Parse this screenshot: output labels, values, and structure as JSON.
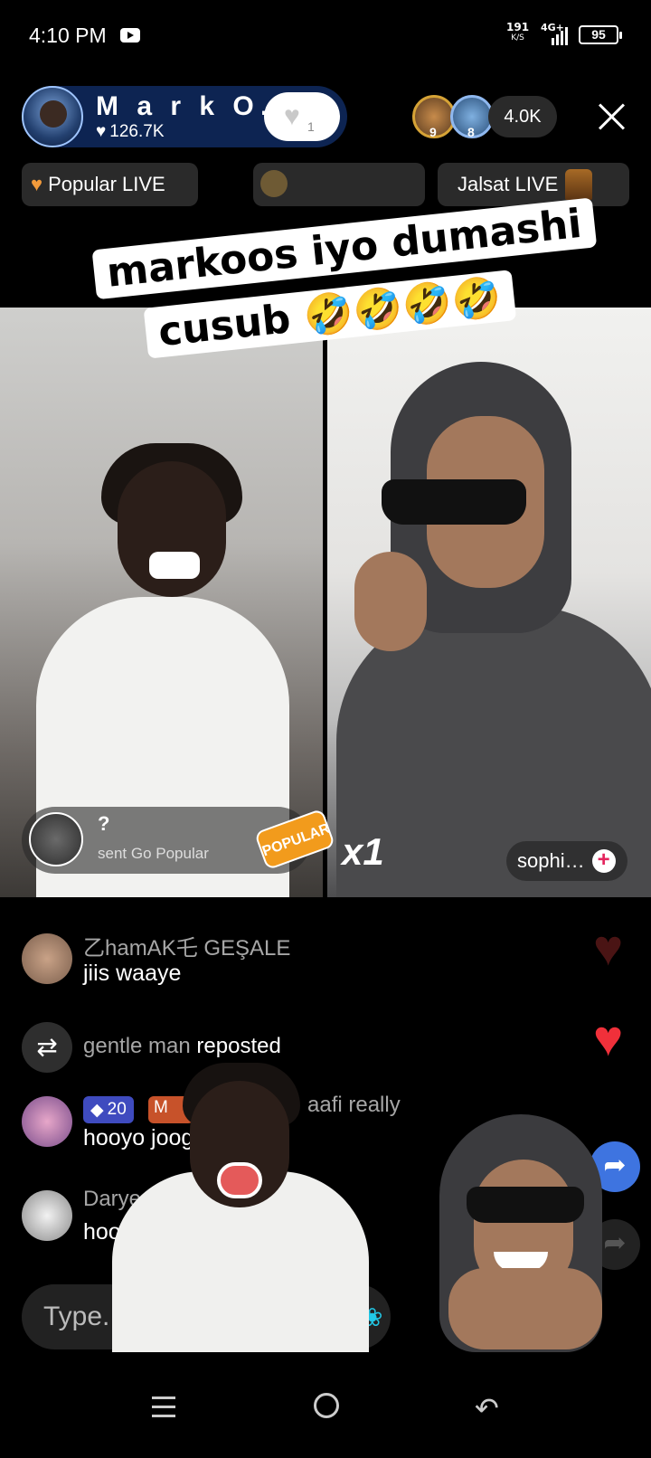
{
  "status_bar": {
    "time": "4:10 PM",
    "net_speed": "191",
    "net_unit": "K/S",
    "network": "4G+",
    "battery": "95"
  },
  "host": {
    "name": "M a r k O…",
    "likes": "126.7K",
    "follow_count": "1"
  },
  "viewers": {
    "ranks": [
      "9",
      "8"
    ],
    "count": "4.0K"
  },
  "pills": {
    "popular": "Popular LIVE",
    "jalsat": "Jalsat LIVE"
  },
  "caption": {
    "line1": "markoos iyo dumashi",
    "line2": "cusub 🤣🤣🤣🤣"
  },
  "gift_banner": {
    "title": "?",
    "subtitle": "sent Go Popular",
    "badge": "POPULAR"
  },
  "battle": {
    "multiplier": "x1",
    "guest_name": "sophi…"
  },
  "chat": [
    {
      "name": "乙hamAK乇 GEŞALE",
      "text": "jiis waaye"
    },
    {
      "name": "gentle man",
      "action": "reposted"
    },
    {
      "badge_level": "20",
      "badge_mod": "M",
      "name": "aafi really",
      "text": "hooyo joog"
    },
    {
      "name": "Darye",
      "text": "hoov"
    }
  ],
  "input": {
    "placeholder": "Type."
  },
  "icons": {
    "heart": "heart-icon",
    "share": "share-icon",
    "close": "close-icon",
    "repost": "repost-icon"
  },
  "colors": {
    "host_pill": "#0d2452",
    "heart_red": "#f0303a",
    "share_blue": "#3e74e0"
  }
}
